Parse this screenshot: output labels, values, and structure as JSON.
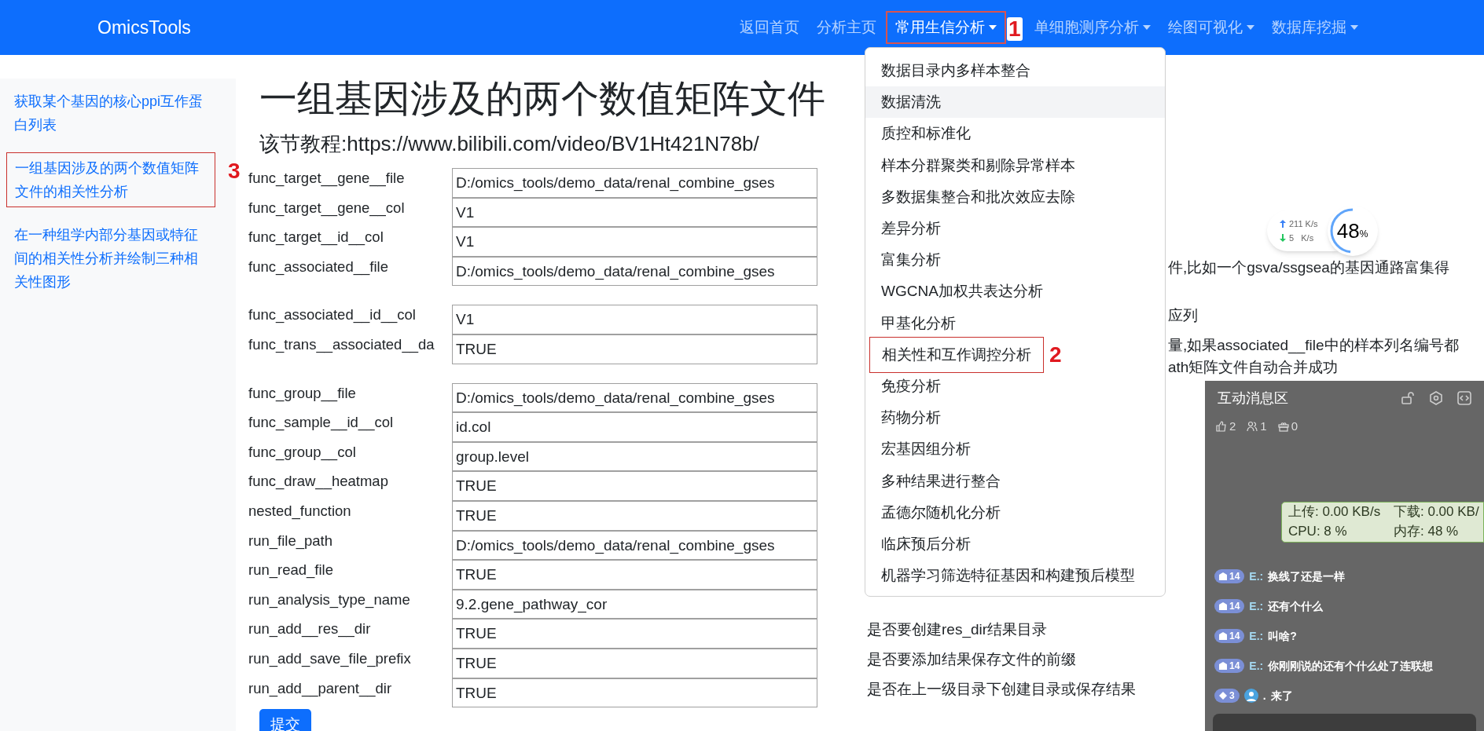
{
  "brand": "OmicsTools",
  "nav": [
    {
      "label": "返回首页",
      "selected": false,
      "dropdown": false
    },
    {
      "label": "分析主页",
      "selected": false,
      "dropdown": false
    },
    {
      "label": "常用生信分析",
      "selected": true,
      "dropdown": true,
      "annotation": "1"
    },
    {
      "label": "单细胞测序分析",
      "selected": false,
      "dropdown": true
    },
    {
      "label": "绘图可视化",
      "selected": false,
      "dropdown": true
    },
    {
      "label": "数据库挖掘",
      "selected": false,
      "dropdown": true
    }
  ],
  "sidebar": {
    "items": [
      {
        "label": "获取某个基因的核心ppi互作蛋白列表"
      },
      {
        "label": "一组基因涉及的两个数值矩阵文件的相关性分析",
        "annotation": "3"
      },
      {
        "label": "在一种组学内部分基因或特征间的相关性分析并绘制三种相关性图形"
      }
    ]
  },
  "page": {
    "title": "一组基因涉及的两个数值矩阵文件",
    "tutorial": "该节教程:https://www.bilibili.com/video/BV1Ht421N78b/"
  },
  "form": {
    "groups": [
      [
        {
          "label": "func_target__gene__file",
          "value": "D:/omics_tools/demo_data/renal_combine_gses"
        },
        {
          "label": "func_target__gene__col",
          "value": "V1"
        },
        {
          "label": "func_target__id__col",
          "value": "V1"
        },
        {
          "label": "func_associated__file",
          "value": "D:/omics_tools/demo_data/renal_combine_gses",
          "description": [
            {
              "text": "件,比如一个gsva/ssgsea的基因通路富集得",
              "clipped": true
            }
          ]
        }
      ],
      [
        {
          "label": "func_associated__id__col",
          "value": "V1",
          "description": [
            {
              "text": "应列",
              "clipped": true
            }
          ]
        },
        {
          "label": "func_trans__associated__da",
          "value": "TRUE",
          "description": [
            {
              "text": "量,如果associated__file中的样本列名编号都",
              "clipped": true
            },
            {
              "text": "ath矩阵文件自动合并成功",
              "clipped": true
            }
          ]
        }
      ],
      [
        {
          "label": "func_group__file",
          "value": "D:/omics_tools/demo_data/renal_combine_gses"
        },
        {
          "label": "func_sample__id__col",
          "value": "id.col"
        },
        {
          "label": "func_group__col",
          "value": "group.level"
        },
        {
          "label": "func_draw__heatmap",
          "value": "TRUE"
        },
        {
          "label": "nested_function",
          "value": "TRUE"
        },
        {
          "label": "run_file_path",
          "value": "D:/omics_tools/demo_data/renal_combine_gses"
        },
        {
          "label": "run_read_file",
          "value": "TRUE"
        },
        {
          "label": "run_analysis_type_name",
          "value": "9.2.gene_pathway_cor"
        },
        {
          "label": "run_add__res__dir",
          "value": "TRUE",
          "description": [
            {
              "text": "是否要创建res_dir结果目录",
              "clipped": false
            }
          ]
        },
        {
          "label": "run_add_save_file_prefix",
          "value": "TRUE",
          "description": [
            {
              "text": "是否要添加结果保存文件的前缀",
              "clipped": false
            }
          ]
        },
        {
          "label": "run_add__parent__dir",
          "value": "TRUE",
          "description": [
            {
              "text": "是否在上一级目录下创建目录或保存结果",
              "clipped": false
            }
          ]
        }
      ]
    ],
    "submit": "提交"
  },
  "dropdown": {
    "items": [
      {
        "label": "数据目录内多样本整合",
        "highlighted": false
      },
      {
        "label": "数据清洗",
        "highlighted": true
      },
      {
        "label": "质控和标准化",
        "highlighted": false
      },
      {
        "label": "样本分群聚类和剔除异常样本",
        "highlighted": false
      },
      {
        "label": "多数据集整合和批次效应去除",
        "highlighted": false
      },
      {
        "label": "差异分析",
        "highlighted": false
      },
      {
        "label": "富集分析",
        "highlighted": false
      },
      {
        "label": "WGCNA加权共表达分析",
        "highlighted": false
      },
      {
        "label": "甲基化分析",
        "highlighted": false
      },
      {
        "label": "相关性和互作调控分析",
        "highlighted": false,
        "annotation": "2"
      },
      {
        "label": "免疫分析",
        "highlighted": false
      },
      {
        "label": "药物分析",
        "highlighted": false
      },
      {
        "label": "宏基因组分析",
        "highlighted": false
      },
      {
        "label": "多种结果进行整合",
        "highlighted": false
      },
      {
        "label": "孟德尔随机化分析",
        "highlighted": false
      },
      {
        "label": "临床预后分析",
        "highlighted": false
      },
      {
        "label": "机器学习筛选特征基因和构建预后模型",
        "highlighted": false
      }
    ]
  },
  "speed_widget": {
    "upload": "211 K/s",
    "download": "5   K/s",
    "percent": "48",
    "unit": "%",
    "level": 0.48
  },
  "chat": {
    "title": "互动消息区",
    "stats": [
      {
        "kind": "likes",
        "count": "2"
      },
      {
        "kind": "users",
        "count": "1"
      },
      {
        "kind": "gifts",
        "count": "0"
      }
    ],
    "monitor": {
      "upload": "上传: 0.00 KB/s",
      "download": "下载: 0.00 KB/",
      "cpu": "CPU: 8 %",
      "memory": "内存: 48 %"
    },
    "messages": [
      {
        "kind": "named",
        "badge": "14",
        "user": "E.:",
        "text": "换线了还是一样"
      },
      {
        "kind": "named",
        "badge": "14",
        "user": "E.:",
        "text": "还有个什么"
      },
      {
        "kind": "named",
        "badge": "14",
        "user": "E.:",
        "text": "叫啥?"
      },
      {
        "kind": "named",
        "badge": "14",
        "user": "E.:",
        "text": "你刚刚说的还有个什么处了连联想"
      },
      {
        "kind": "avatar",
        "badge": "3",
        "user": ".",
        "text": "来了"
      }
    ]
  }
}
